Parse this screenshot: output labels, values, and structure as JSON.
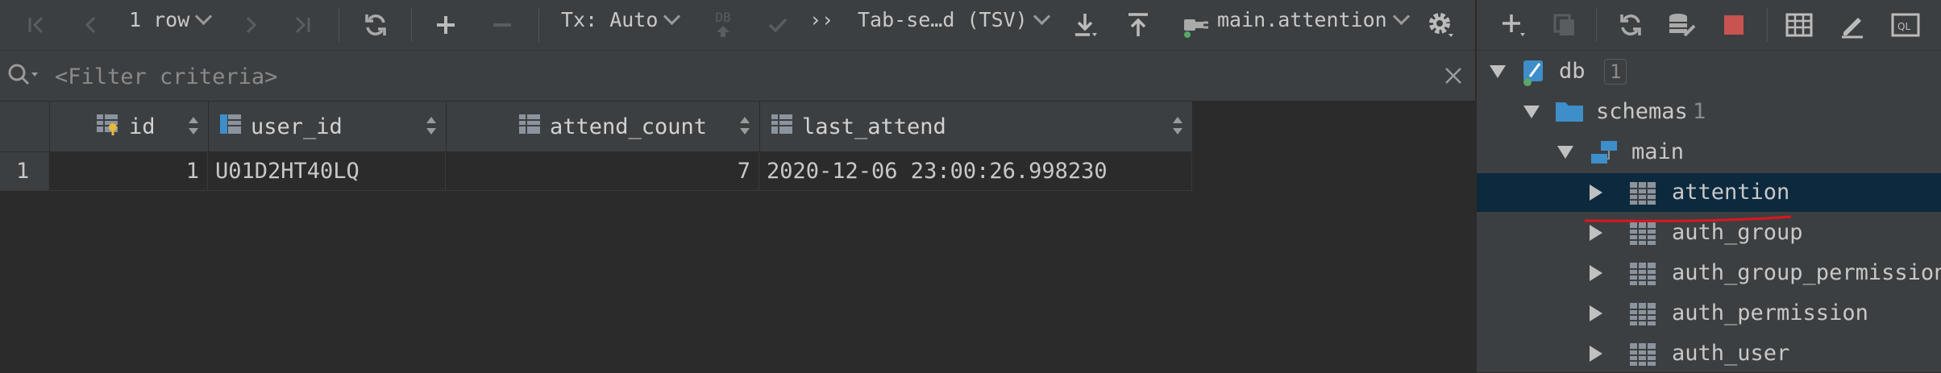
{
  "toolbar": {
    "row_count": "1 row",
    "tx_mode": "Tx: Auto",
    "db_badge": "DB",
    "more": "››",
    "export_format": "Tab-se…d (TSV)",
    "current_table": "main.attention"
  },
  "filter": {
    "placeholder": "<Filter criteria>"
  },
  "grid": {
    "columns": [
      {
        "name": "id"
      },
      {
        "name": "user_id"
      },
      {
        "name": "attend_count"
      },
      {
        "name": "last_attend"
      }
    ],
    "rows": [
      {
        "num": "1",
        "id": "1",
        "user_id": "U01D2HT40LQ",
        "attend_count": "7",
        "last_attend": "2020-12-06 23:00:26.998230"
      }
    ]
  },
  "tree": {
    "db": {
      "label": "db",
      "badge": "1"
    },
    "schemas": {
      "label": "schemas",
      "count": "1"
    },
    "main": {
      "label": "main"
    },
    "tables": [
      "attention",
      "auth_group",
      "auth_group_permissions",
      "auth_permission",
      "auth_user"
    ]
  },
  "colors": {
    "bg": "#2b2b2b",
    "panel": "#3c3f41",
    "selection": "#0d293e",
    "annotation": "#e0141e",
    "stop": "#c75450"
  }
}
